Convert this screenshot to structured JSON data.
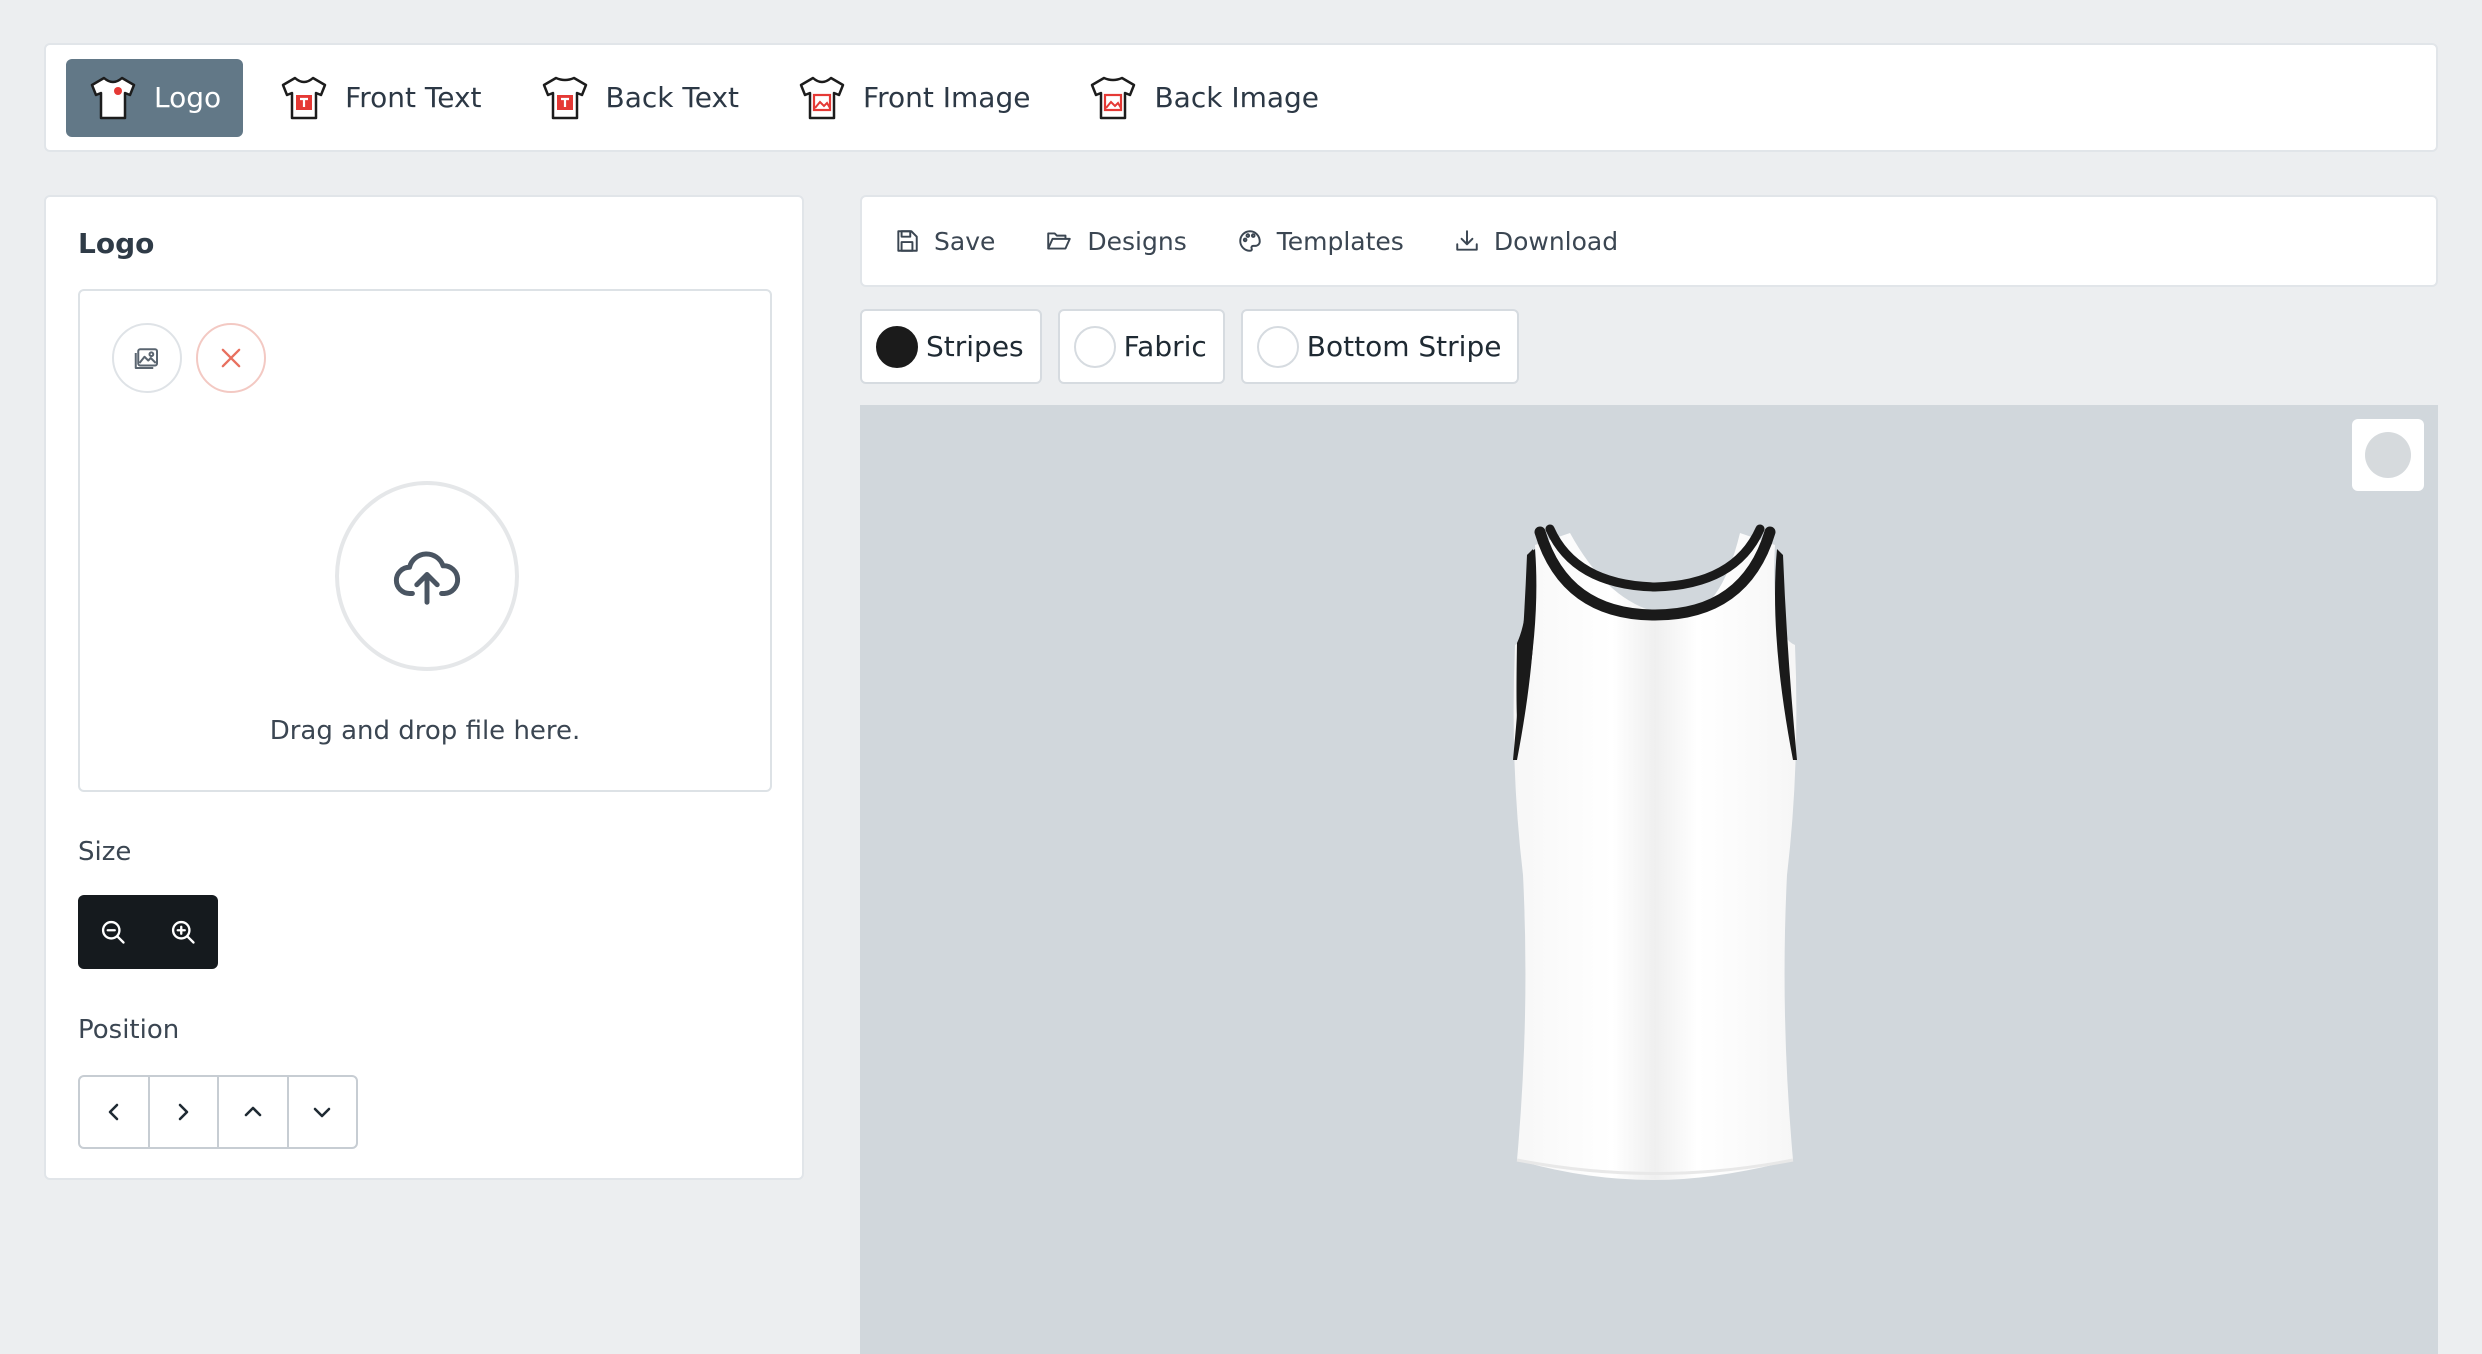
{
  "tabs": [
    {
      "label": "Logo",
      "icon": "tshirt-logo-icon",
      "active": true
    },
    {
      "label": "Front Text",
      "icon": "tshirt-text-icon",
      "active": false
    },
    {
      "label": "Back Text",
      "icon": "tshirt-text-icon",
      "active": false
    },
    {
      "label": "Front Image",
      "icon": "tshirt-image-icon",
      "active": false
    },
    {
      "label": "Back Image",
      "icon": "tshirt-image-icon",
      "active": false
    }
  ],
  "left_panel": {
    "title": "Logo",
    "dropzone": {
      "text": "Drag and drop file here.",
      "image_button_icon": "image-icon",
      "remove_button_icon": "close-icon",
      "upload_icon": "cloud-upload-icon"
    },
    "size_label": "Size",
    "size_buttons": [
      "zoom-out-icon",
      "zoom-in-icon"
    ],
    "position_label": "Position",
    "position_buttons": [
      "chevron-left-icon",
      "chevron-right-icon",
      "chevron-up-icon",
      "chevron-down-icon"
    ]
  },
  "toolbar": {
    "save": "Save",
    "designs": "Designs",
    "templates": "Templates",
    "download": "Download"
  },
  "chips": [
    {
      "label": "Stripes",
      "color": "#1b1b1b"
    },
    {
      "label": "Fabric",
      "color": "#ffffff"
    },
    {
      "label": "Bottom Stripe",
      "color": "#ffffff"
    }
  ],
  "colors": {
    "accent_tab": "#627887",
    "canvas_bg": "#d1d7dc",
    "icon_red": "#e53935",
    "delete_red": "#e8705f"
  }
}
